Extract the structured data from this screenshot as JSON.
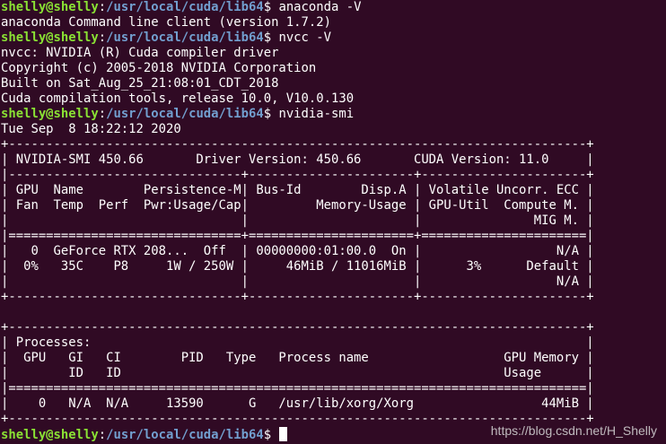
{
  "prompt": {
    "user": "shelly@shelly",
    "sep": ":",
    "path": "/usr/local/cuda/lib64",
    "symbol": "$ "
  },
  "commands": {
    "c1": "anaconda -V",
    "c2": "nvcc -V",
    "c3": "nvidia-smi"
  },
  "output": {
    "o1": "anaconda Command line client (version 1.7.2)",
    "o2": "nvcc: NVIDIA (R) Cuda compiler driver",
    "o3": "Copyright (c) 2005-2018 NVIDIA Corporation",
    "o4": "Built on Sat_Aug_25_21:08:01_CDT_2018",
    "o5": "Cuda compilation tools, release 10.0, V10.0.130",
    "o6": "Tue Sep  8 18:22:12 2020"
  },
  "smi": {
    "l01": "+-----------------------------------------------------------------------------+",
    "l02": "| NVIDIA-SMI 450.66       Driver Version: 450.66       CUDA Version: 11.0     |",
    "l03": "|-------------------------------+----------------------+----------------------+",
    "l04": "| GPU  Name        Persistence-M| Bus-Id        Disp.A | Volatile Uncorr. ECC |",
    "l05": "| Fan  Temp  Perf  Pwr:Usage/Cap|         Memory-Usage | GPU-Util  Compute M. |",
    "l06": "|                               |                      |               MIG M. |",
    "l07": "|===============================+======================+======================|",
    "l08": "|   0  GeForce RTX 208...  Off  | 00000000:01:00.0  On |                  N/A |",
    "l09": "|  0%   35C    P8     1W / 250W |     46MiB / 11016MiB |      3%      Default |",
    "l10": "|                               |                      |                  N/A |",
    "l11": "+-------------------------------+----------------------+----------------------+",
    "l12": "",
    "l13": "+-----------------------------------------------------------------------------+",
    "l14": "| Processes:                                                                  |",
    "l15": "|  GPU   GI   CI        PID   Type   Process name                  GPU Memory |",
    "l16": "|        ID   ID                                                   Usage      |",
    "l17": "|=============================================================================|",
    "l18": "|    0   N/A  N/A     13590      G   /usr/lib/xorg/Xorg                 44MiB |",
    "l19": "+-----------------------------------------------------------------------------+"
  },
  "watermark": "https://blog.csdn.net/H_Shelly"
}
